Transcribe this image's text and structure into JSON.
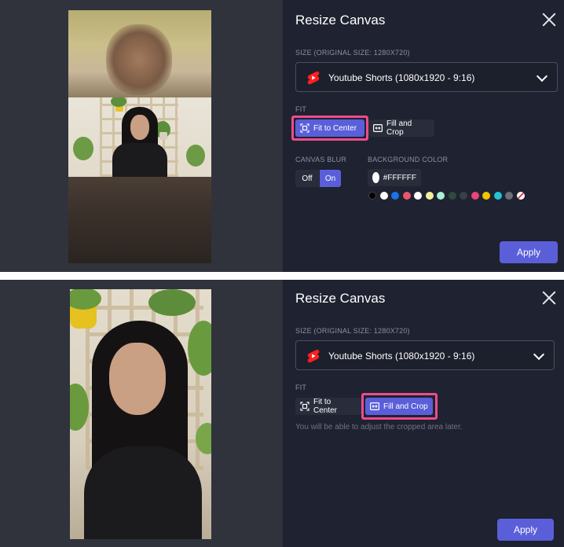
{
  "top": {
    "title": "Resize Canvas",
    "size_label": "SIZE (ORIGINAL SIZE: 1280X720)",
    "select_value": "Youtube Shorts (1080x1920 - 9:16)",
    "fit_label": "FIT",
    "fit_center": "Fit to Center",
    "fill_crop": "Fill and Crop",
    "canvas_blur_label": "CANVAS BLUR",
    "blur_off": "Off",
    "blur_on": "On",
    "bg_color_label": "BACKGROUND COLOR",
    "bg_color_value": "#FFFFFF",
    "apply": "Apply",
    "active_fit": "Fit to Center",
    "canvas_blur": "On"
  },
  "bottom": {
    "title": "Resize Canvas",
    "size_label": "SIZE (ORIGINAL SIZE: 1280X720)",
    "select_value": "Youtube Shorts (1080x1920 - 9:16)",
    "fit_label": "FIT",
    "fit_center": "Fit to Center",
    "fill_crop": "Fill and Crop",
    "helper": "You will be able to adjust the cropped area later.",
    "apply": "Apply",
    "active_fit": "Fill and Crop"
  },
  "colors": {
    "accent": "#5a5fd9",
    "highlight": "#ef4b8d",
    "panel_bg": "#1f2230",
    "swatches": [
      "#000000",
      "#ffffff",
      "#1a73e8",
      "#e8576b",
      "#ffffff",
      "#f4ef9c",
      "#a8f0d8",
      "#2e4a3e",
      "#3a3f4a",
      "#e8457a",
      "#f5c400",
      "#22c4d4",
      "#6c6f78",
      "none"
    ]
  },
  "icons": [
    "youtube-shorts-icon",
    "chevron-down-icon",
    "close-icon",
    "fit-to-center-icon",
    "fill-and-crop-icon"
  ]
}
